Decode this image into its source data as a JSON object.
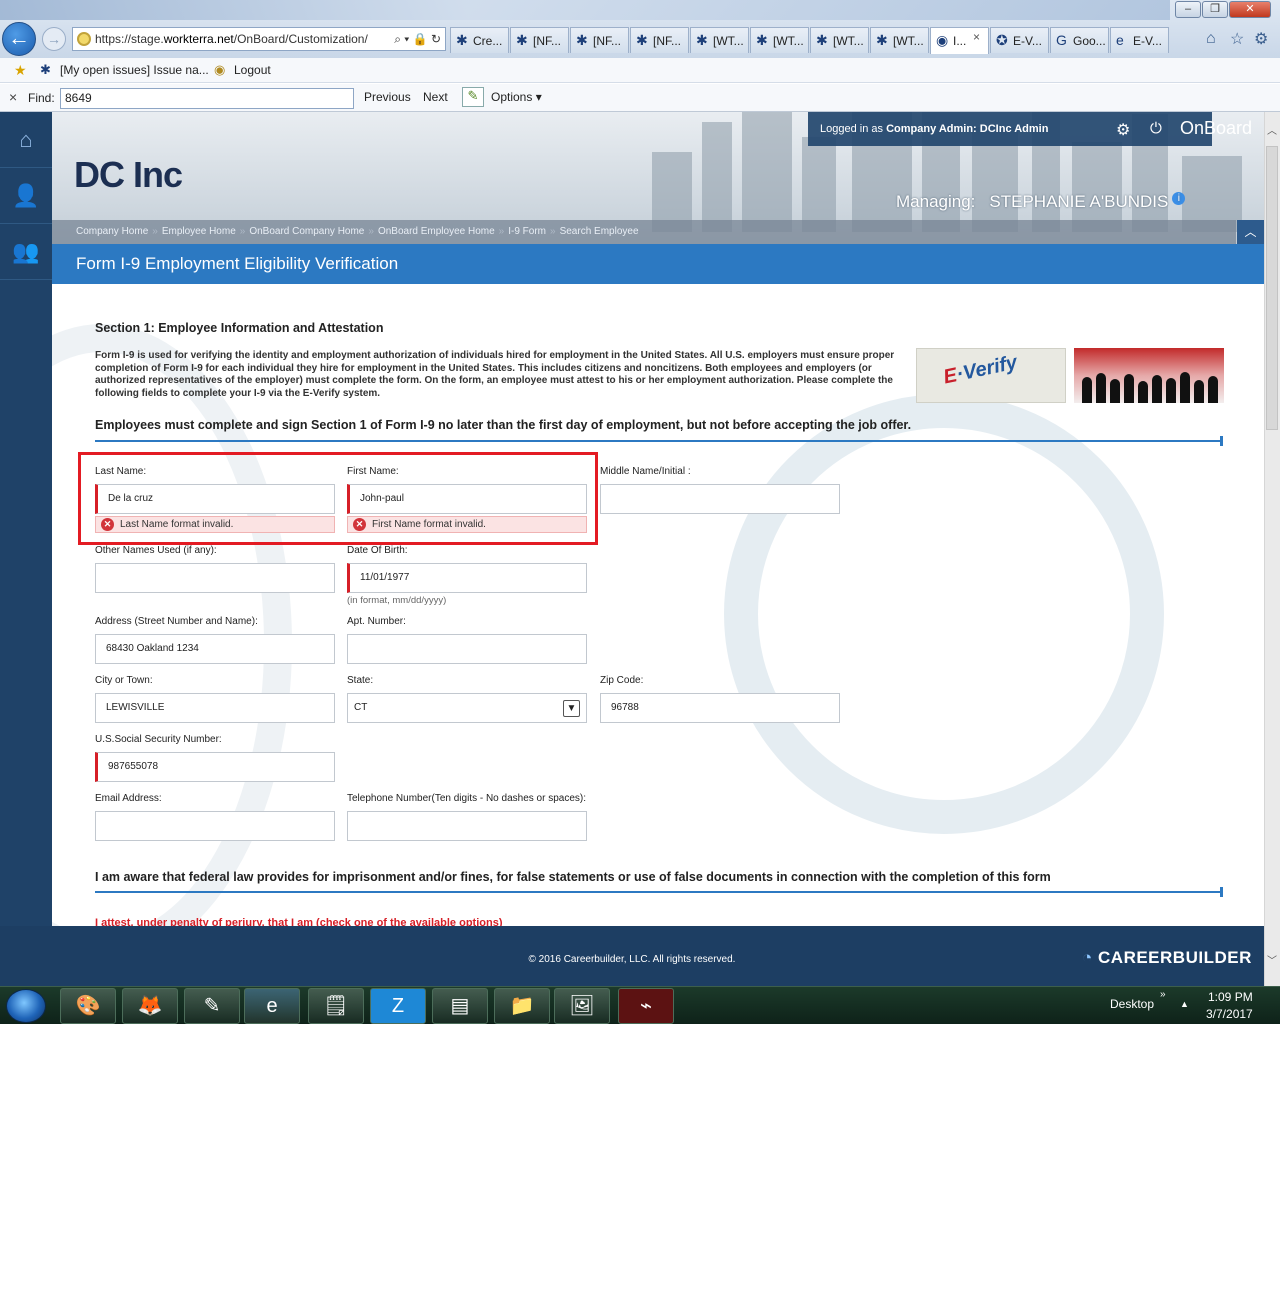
{
  "browser": {
    "url_prefix": "https://stage.",
    "url_domain": "workterra.net",
    "url_rest": "/OnBoard/Customization/",
    "addr_tools": "⌕ ▾ 🔒 ↻",
    "tabs": [
      {
        "icon": "✱",
        "label": "Cre..."
      },
      {
        "icon": "✱",
        "label": "[NF..."
      },
      {
        "icon": "✱",
        "label": "[NF..."
      },
      {
        "icon": "✱",
        "label": "[NF..."
      },
      {
        "icon": "✱",
        "label": "[WT..."
      },
      {
        "icon": "✱",
        "label": "[WT..."
      },
      {
        "icon": "✱",
        "label": "[WT..."
      },
      {
        "icon": "✱",
        "label": "[WT..."
      },
      {
        "icon": "◉",
        "label": "I..."
      },
      {
        "icon": "✪",
        "label": "E-V..."
      },
      {
        "icon": "G",
        "label": "Goo..."
      },
      {
        "icon": "e",
        "label": "E-V..."
      }
    ],
    "tab_close": "×",
    "favorites": [
      {
        "label": "[My open issues] Issue na..."
      },
      {
        "label": "Logout"
      }
    ],
    "find": {
      "close": "×",
      "label": "Find:",
      "value": "8649",
      "previous": "Previous",
      "next": "Next",
      "options": "Options"
    }
  },
  "app": {
    "logo": "DC Inc",
    "logged_in_prefix": "Logged in as",
    "logged_in_role": "Company Admin:",
    "logged_in_user": "DCInc Admin",
    "brand": "OnBoard",
    "managing_label": "Managing:",
    "managing_name": "STEPHANIE A'BUNDIS",
    "breadcrumb": [
      "Company Home",
      "Employee Home",
      "OnBoard Company Home",
      "OnBoard Employee Home",
      "I-9 Form",
      "Search Employee"
    ],
    "breadcrumb_sep": "»",
    "form_title": "Form I-9 Employment Eligibility Verification"
  },
  "form": {
    "section_title": "Section 1: Employee Information and Attestation",
    "intro": "Form I-9 is used for verifying the identity and employment authorization of individuals hired for employment in the United States. All U.S. employers must ensure proper completion of Form I-9 for each individual they hire for employment in the United States. This includes citizens and noncitizens. Both employees and employers (or authorized representatives of the employer) must complete the form. On the form, an employee must attest to his or her employment authorization. Please complete the following fields to complete your I-9 via the E-Verify system.",
    "everify_e": "E",
    "everify_rest": "·Verify",
    "must_sign": "Employees must complete and sign Section 1 of Form I-9 no later than the first day of employment, but not before accepting the job offer.",
    "fields": {
      "last_name": {
        "label": "Last Name:",
        "value": "De la cruz",
        "error": "Last Name format invalid."
      },
      "first_name": {
        "label": "First Name:",
        "value": "John-paul",
        "error": "First Name format invalid."
      },
      "middle_name": {
        "label": "Middle Name/Initial :",
        "value": ""
      },
      "other_names": {
        "label": "Other Names Used (if any):",
        "value": ""
      },
      "dob": {
        "label": "Date Of Birth:",
        "value": "11/01/1977",
        "hint": "(in format, mm/dd/yyyy)"
      },
      "address": {
        "label": "Address (Street Number and Name):",
        "value": "68430 Oakland 1234"
      },
      "apt": {
        "label": "Apt. Number:",
        "value": ""
      },
      "city": {
        "label": "City or Town:",
        "value": "LEWISVILLE"
      },
      "state": {
        "label": "State:",
        "value": "CT"
      },
      "zip": {
        "label": "Zip Code:",
        "value": "96788"
      },
      "ssn": {
        "label": "U.S.Social Security Number:",
        "value": "987655078"
      },
      "email": {
        "label": "Email Address:",
        "value": ""
      },
      "phone": {
        "label": "Telephone Number(Ten digits - No dashes or spaces):",
        "value": ""
      }
    },
    "aware": "I am aware that federal law provides for imprisonment and/or fines, for false statements or use of false documents in connection with the completion of this form",
    "attest": "I attest, under penalty of perjury, that I am (check one of the available options)"
  },
  "footer": {
    "copyright": "© 2016 Careerbuilder, LLC. All rights reserved.",
    "cb_logo": "CAREERBUILDER"
  },
  "taskbar": {
    "desktop": "Desktop",
    "tray_arrow": "»",
    "time": "1:09 PM",
    "date": "3/7/2017"
  },
  "colors": {
    "accent_blue": "#2c79c2",
    "navy": "#1d3e63",
    "error_red": "#d61f27"
  }
}
